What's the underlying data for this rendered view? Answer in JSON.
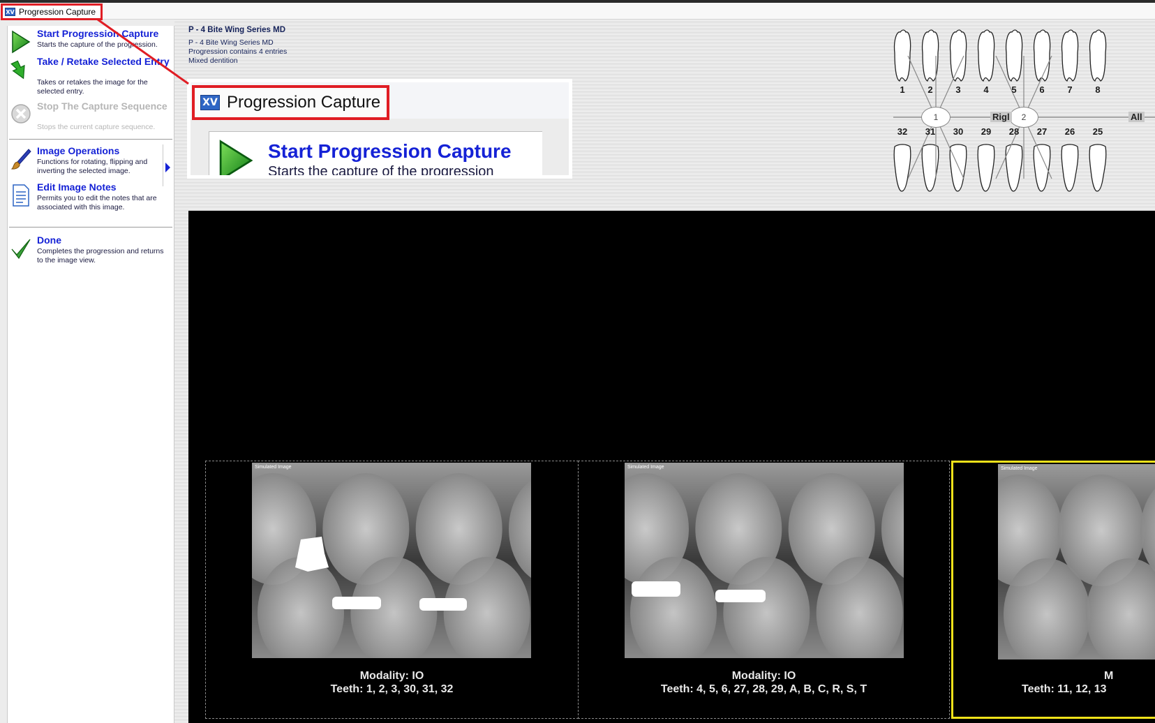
{
  "window": {
    "title": "Progression Capture",
    "icon": "xv-app-icon",
    "icon_text": "XV"
  },
  "sidebar": {
    "tasks": [
      {
        "label": "Start Progression Capture",
        "desc": "Starts the capture of the progression.",
        "icon": "play-icon",
        "enabled": true
      },
      {
        "label": "Take / Retake Selected Entry",
        "desc": "Takes or retakes the image for the selected entry.",
        "icon": "retake-arrow-icon",
        "enabled": true
      },
      {
        "label": "Stop The Capture Sequence",
        "desc": "Stops the current capture sequence.",
        "icon": "stop-icon",
        "enabled": false
      },
      {
        "label": "Image Operations",
        "desc": "Functions for rotating, flipping and inverting the selected image.",
        "icon": "brush-icon",
        "enabled": true
      },
      {
        "label": "Edit Image Notes",
        "desc": "Permits you to edit the notes that are associated with this image.",
        "icon": "notes-icon",
        "enabled": true
      },
      {
        "label": "Done",
        "desc": "Completes the progression and returns to the image view.",
        "icon": "checkmark-icon",
        "enabled": true
      }
    ]
  },
  "info": {
    "heading": "P - 4 Bite Wing Series MD",
    "lines": [
      "P - 4 Bite Wing Series MD",
      "Progression contains 4 entries",
      "Mixed dentition"
    ]
  },
  "zoom": {
    "title": "Progression Capture",
    "task_label": "Start Progression Capture",
    "task_desc": "Starts the capture of the progression"
  },
  "tooth_chart": {
    "upper_numbers": [
      "1",
      "2",
      "3",
      "4",
      "5",
      "6",
      "7",
      "8"
    ],
    "lower_numbers": [
      "32",
      "31",
      "30",
      "29",
      "28",
      "27",
      "26",
      "25"
    ],
    "quadrant_buttons": [
      "1",
      "2"
    ],
    "side_label": "Rigl",
    "all_label": "All"
  },
  "thumbnails": [
    {
      "sim_label": "Simulated Image",
      "modality": "Modality: IO",
      "teeth": "Teeth: 1, 2, 3, 30, 31, 32",
      "selected": false
    },
    {
      "sim_label": "Simulated Image",
      "modality": "Modality: IO",
      "teeth": "Teeth: 4, 5, 6, 27, 28, 29, A, B, C, R, S, T",
      "selected": false
    },
    {
      "sim_label": "Simulated Image",
      "modality": "M",
      "teeth": "Teeth: 11, 12, 13",
      "selected": true
    }
  ],
  "colors": {
    "task_link": "#1522d6",
    "highlight": "#e01d24",
    "selection": "#f0e21a"
  }
}
